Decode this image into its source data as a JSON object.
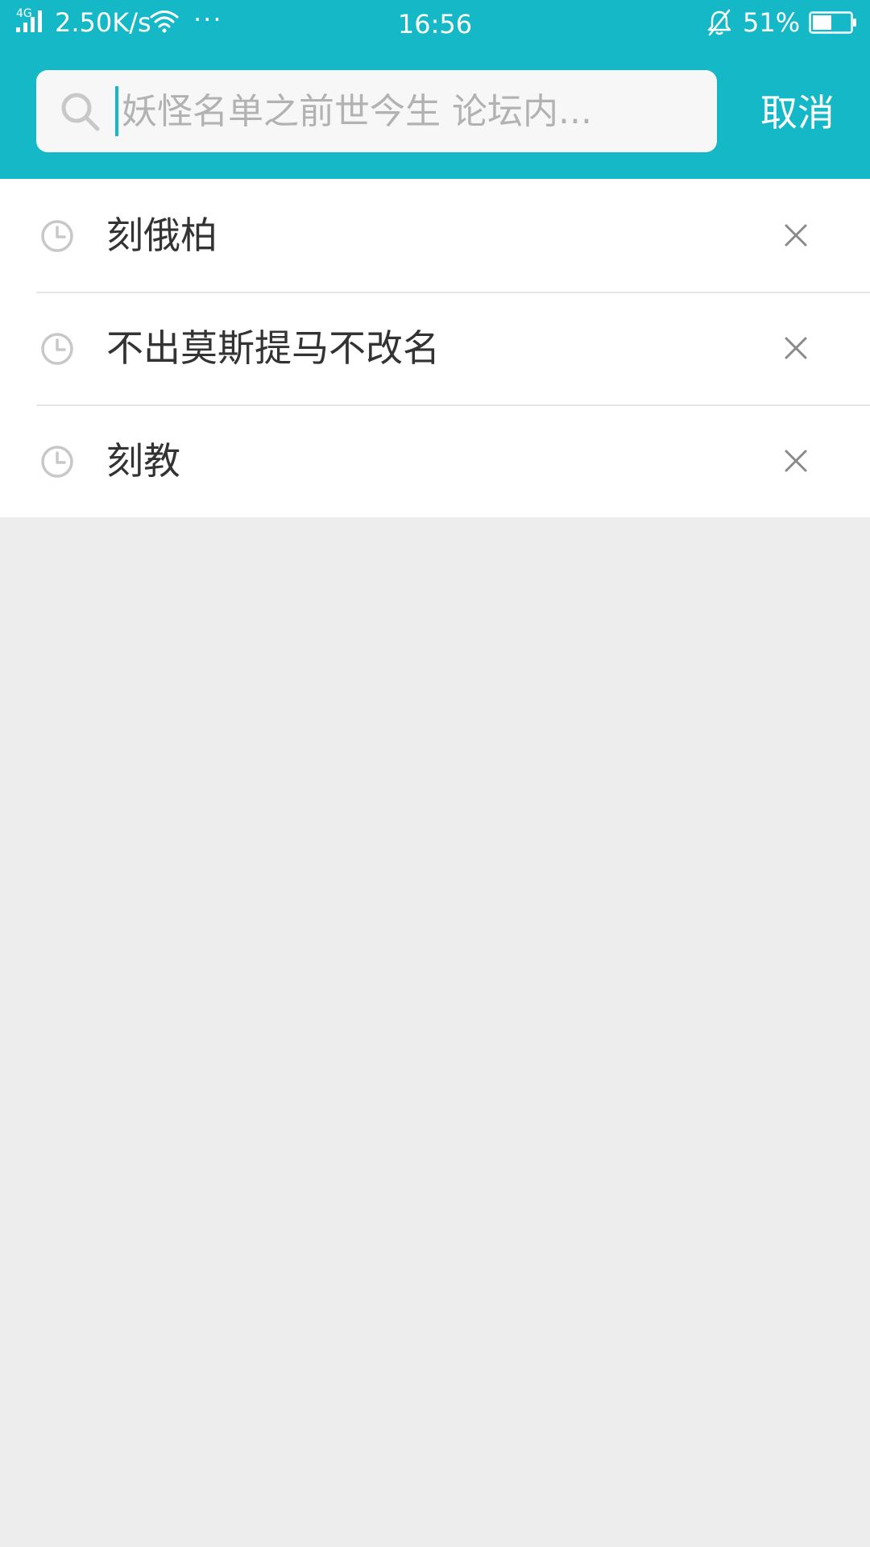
{
  "status_bar": {
    "network_type": "4G",
    "speed": "2.50K/s",
    "more": "···",
    "time": "16:56",
    "battery": "51%",
    "battery_level": 0.51
  },
  "search": {
    "placeholder": "妖怪名单之前世今生 论坛内...",
    "value": "",
    "cancel_label": "取消"
  },
  "history": {
    "items": [
      {
        "label": "刻俄柏"
      },
      {
        "label": "不出莫斯提马不改名"
      },
      {
        "label": "刻教"
      }
    ]
  },
  "colors": {
    "accent": "#14b8c6",
    "background": "#ededed",
    "text": "#333333",
    "icon_gray": "#c8c8c8"
  }
}
